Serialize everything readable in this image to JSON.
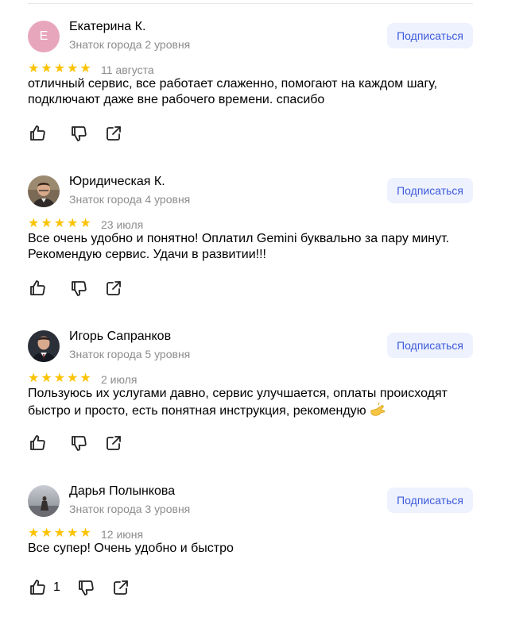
{
  "reviews": [
    {
      "author": "Екатерина К.",
      "level": "Знаток города 2 уровня",
      "avatar_letter": "Е",
      "subscribe_label": "Подписаться",
      "rating": 5,
      "date": "11 августа",
      "text": "отличный сервис, все работает слаженно, помогают на каждом шагу, подключают даже вне рабочего времени. спасибо",
      "likes": ""
    },
    {
      "author": "Юридическая К.",
      "level": "Знаток города 4 уровня",
      "subscribe_label": "Подписаться",
      "rating": 5,
      "date": "23 июля",
      "text": "Все очень удобно и понятно! Оплатил Gemini буквально за пару минут. Рекомендую сервис. Удачи в развитии!!!",
      "likes": ""
    },
    {
      "author": "Игорь Сапранков",
      "level": "Знаток города 5 уровня",
      "subscribe_label": "Подписаться",
      "rating": 5,
      "date": "2 июля",
      "text": "Пользуюсь их услугами давно, сервис улучшается, оплаты происходят быстро и просто, есть понятная инструкция, рекомендую",
      "likes": ""
    },
    {
      "author": "Дарья Полынкова",
      "level": "Знаток города 3 уровня",
      "subscribe_label": "Подписаться",
      "rating": 5,
      "date": "12 июня",
      "text": "Все супер! Очень удобно и быстро",
      "likes": "1"
    }
  ],
  "icons": {
    "like": "thumbs-up-icon",
    "dislike": "thumbs-down-icon",
    "share": "share-icon",
    "star": "star-icon",
    "emoji": "pinching-hand-emoji"
  },
  "colors": {
    "star": "#fcc300",
    "subscribe_bg": "#eef2ff",
    "subscribe_text": "#3d5ad9",
    "muted_text": "#8c8c8c",
    "avatar_1": "#e7a6bc"
  }
}
